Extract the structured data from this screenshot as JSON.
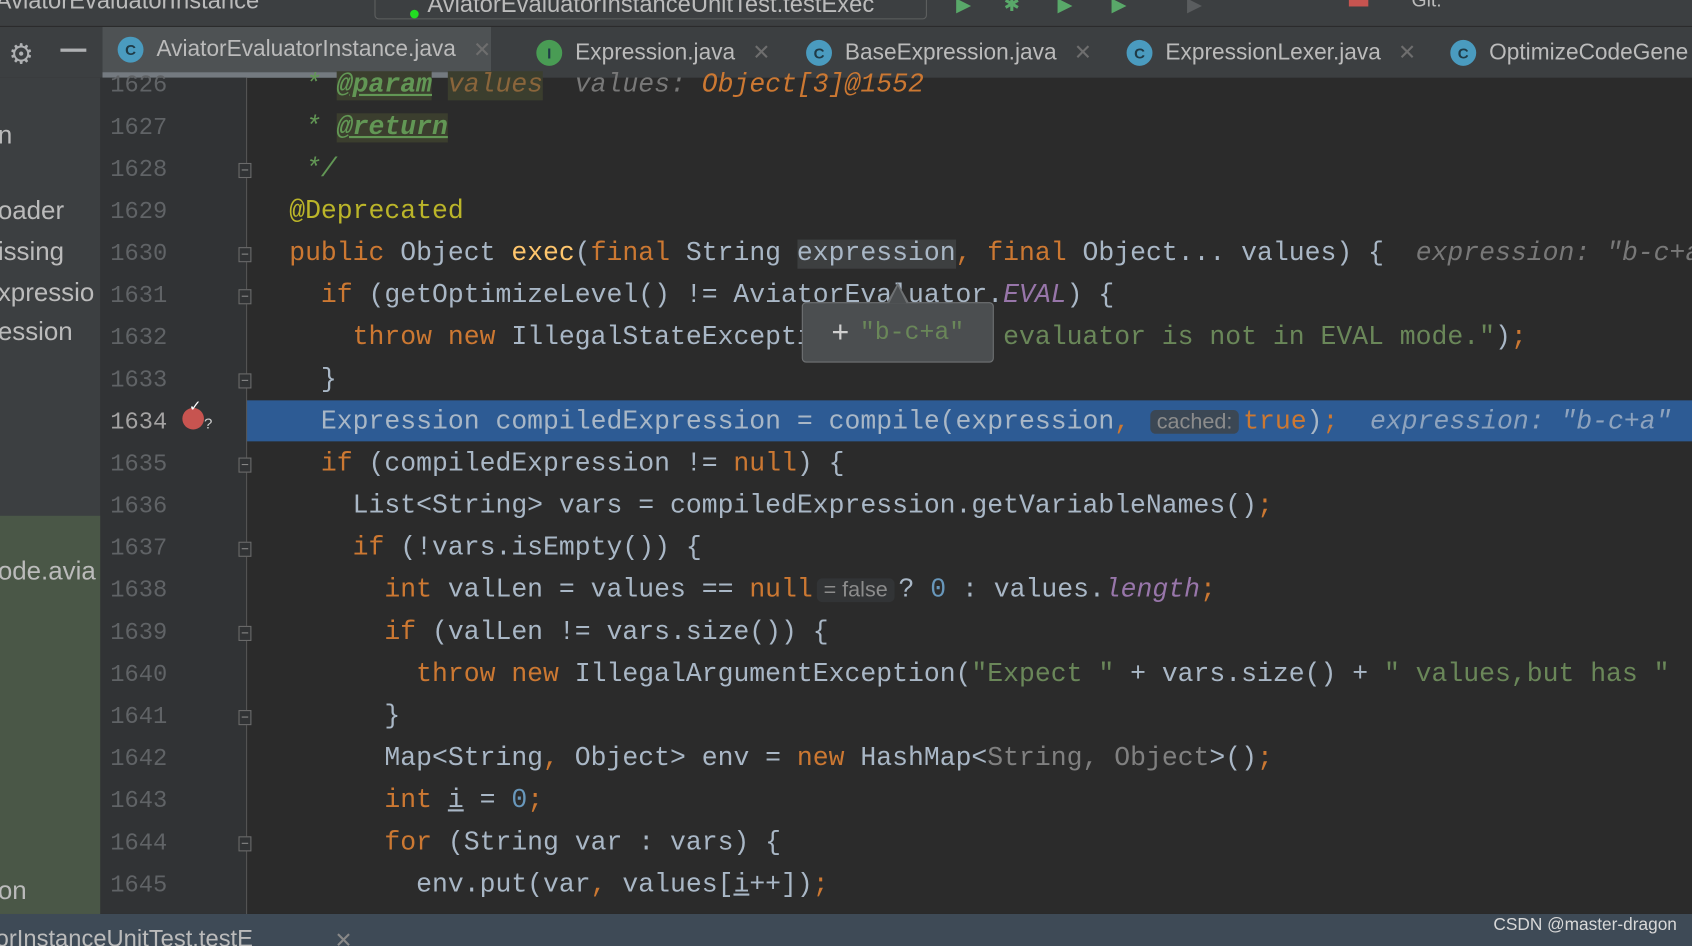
{
  "window": {
    "title": "AviatorEvaluatorInstance",
    "run_config": "AviatorEvaluatorInstanceUnitTest.testExec",
    "toolbar_extra": "Git:"
  },
  "tabs": [
    {
      "label": "AviatorEvaluatorInstance.java",
      "icon": "C",
      "color": "#4a9bbf",
      "active": true
    },
    {
      "label": "Expression.java",
      "icon": "I",
      "color": "#499c54"
    },
    {
      "label": "BaseExpression.java",
      "icon": "C",
      "color": "#4a9bbf"
    },
    {
      "label": "ExpressionLexer.java",
      "icon": "C",
      "color": "#4a9bbf"
    },
    {
      "label": "OptimizeCodeGene",
      "icon": "C",
      "color": "#4a9bbf"
    }
  ],
  "sidebar": {
    "items": [
      "n",
      "oader",
      "issing",
      "xpressio",
      "ession",
      "ode.avia",
      "on"
    ]
  },
  "current_line": "1634",
  "code": [
    {
      "n": "1626",
      "t": [
        [
          "cm",
          " * "
        ],
        [
          "tag",
          "@param"
        ],
        [
          "cm",
          " "
        ],
        [
          "pname",
          "values"
        ],
        [
          "hint",
          "  values: "
        ],
        [
          "hinto",
          "Object[3]@1552"
        ]
      ]
    },
    {
      "n": "1627",
      "t": [
        [
          "cm",
          " * "
        ],
        [
          "tag",
          "@return"
        ]
      ]
    },
    {
      "n": "1628",
      "t": [
        [
          "cm",
          " */"
        ]
      ]
    },
    {
      "n": "1629",
      "t": [
        [
          "ann",
          "@Deprecated"
        ]
      ]
    },
    {
      "n": "1630",
      "t": [
        [
          "kw",
          "public "
        ],
        [
          "",
          "Object "
        ],
        [
          "fn",
          "exec"
        ],
        [
          "",
          "("
        ],
        [
          "kw",
          "final "
        ],
        [
          "",
          "String "
        ],
        [
          "selw",
          "expression"
        ],
        [
          "kw",
          ", final "
        ],
        [
          "",
          "Object... values) {"
        ],
        [
          "hint",
          "  expression: \"b-c+a\""
        ]
      ]
    },
    {
      "n": "1631",
      "t": [
        [
          "kw",
          "  if "
        ],
        [
          "",
          "(getOptimizeLevel() != AviatorEvaluator."
        ],
        [
          "const",
          "EVAL"
        ],
        [
          "",
          ") {"
        ]
      ]
    },
    {
      "n": "1632",
      "t": [
        [
          "kw",
          "    throw new "
        ],
        [
          "",
          "IllegalStateException("
        ],
        [
          "str",
          "\"Aviator evaluator is not in EVAL mode.\""
        ],
        [
          "",
          ")"
        ],
        [
          "kw",
          ";"
        ]
      ]
    },
    {
      "n": "1633",
      "t": [
        [
          "",
          "  }"
        ]
      ]
    },
    {
      "n": "1634",
      "t": [
        [
          "",
          "  Expression compiledExpression = compile(expression"
        ],
        [
          "kw",
          ", "
        ],
        [
          "inlay",
          "cached:"
        ],
        [
          "kw",
          "true"
        ],
        [
          "",
          ")"
        ],
        [
          "kw",
          ";"
        ],
        [
          "hint",
          "  expression: \"b-c+a\""
        ]
      ]
    },
    {
      "n": "1635",
      "t": [
        [
          "kw",
          "  if "
        ],
        [
          "",
          "(compiledExpression != "
        ],
        [
          "kw",
          "null"
        ],
        [
          "",
          ") {"
        ]
      ]
    },
    {
      "n": "1636",
      "t": [
        [
          "",
          "    List<String> vars = compiledExpression.getVariableNames()"
        ],
        [
          "kw",
          ";"
        ]
      ]
    },
    {
      "n": "1637",
      "t": [
        [
          "kw",
          "    if "
        ],
        [
          "",
          "(!vars.isEmpty()) {"
        ]
      ]
    },
    {
      "n": "1638",
      "t": [
        [
          "kw",
          "      int "
        ],
        [
          "",
          "valLen = values == "
        ],
        [
          "kw",
          "null"
        ],
        [
          "inlay2",
          "= false"
        ],
        [
          "",
          "? "
        ],
        [
          "num",
          "0"
        ],
        [
          "",
          " : values."
        ],
        [
          "const",
          "length"
        ],
        [
          "kw",
          ";"
        ]
      ]
    },
    {
      "n": "1639",
      "t": [
        [
          "kw",
          "      if "
        ],
        [
          "",
          "(valLen != vars.size()) {"
        ]
      ]
    },
    {
      "n": "1640",
      "t": [
        [
          "kw",
          "        throw new "
        ],
        [
          "",
          "IllegalArgumentException("
        ],
        [
          "str",
          "\"Expect \""
        ],
        [
          "",
          " + vars.size() + "
        ],
        [
          "str",
          "\" values,but has \""
        ]
      ]
    },
    {
      "n": "1641",
      "t": [
        [
          "",
          "      }"
        ]
      ]
    },
    {
      "n": "1642",
      "t": [
        [
          "",
          "      Map<String"
        ],
        [
          "kw",
          ", "
        ],
        [
          "",
          "Object> env = "
        ],
        [
          "kw",
          "new "
        ],
        [
          "",
          "HashMap<"
        ],
        [
          "gen",
          "String, Object"
        ],
        [
          "",
          ">()"
        ],
        [
          "kw",
          ";"
        ]
      ]
    },
    {
      "n": "1643",
      "t": [
        [
          "kw",
          "      int "
        ],
        [
          "ul",
          "i"
        ],
        [
          "",
          " = "
        ],
        [
          "num",
          "0"
        ],
        [
          "kw",
          ";"
        ]
      ]
    },
    {
      "n": "1644",
      "t": [
        [
          "kw",
          "      for "
        ],
        [
          "",
          "(String var : vars) {"
        ]
      ]
    },
    {
      "n": "1645",
      "t": [
        [
          "",
          "        env.put(var"
        ],
        [
          "kw",
          ", "
        ],
        [
          "",
          "values["
        ],
        [
          "ul",
          "i"
        ],
        [
          "",
          "++])"
        ],
        [
          "kw",
          ";"
        ]
      ]
    }
  ],
  "folds": [
    "1628",
    "1630",
    "1631",
    "1633",
    "1635",
    "1637",
    "1639",
    "1641",
    "1644"
  ],
  "popup": {
    "value": "\"b-c+a\""
  },
  "bottom": {
    "tab": "orInstanceUnitTest.testE",
    "watermark": "CSDN @master-dragon"
  },
  "colors": {
    "highlight": "#2d5b94",
    "breakpoint": "#c75450",
    "keyword": "#cc7832",
    "string": "#6a8759"
  }
}
